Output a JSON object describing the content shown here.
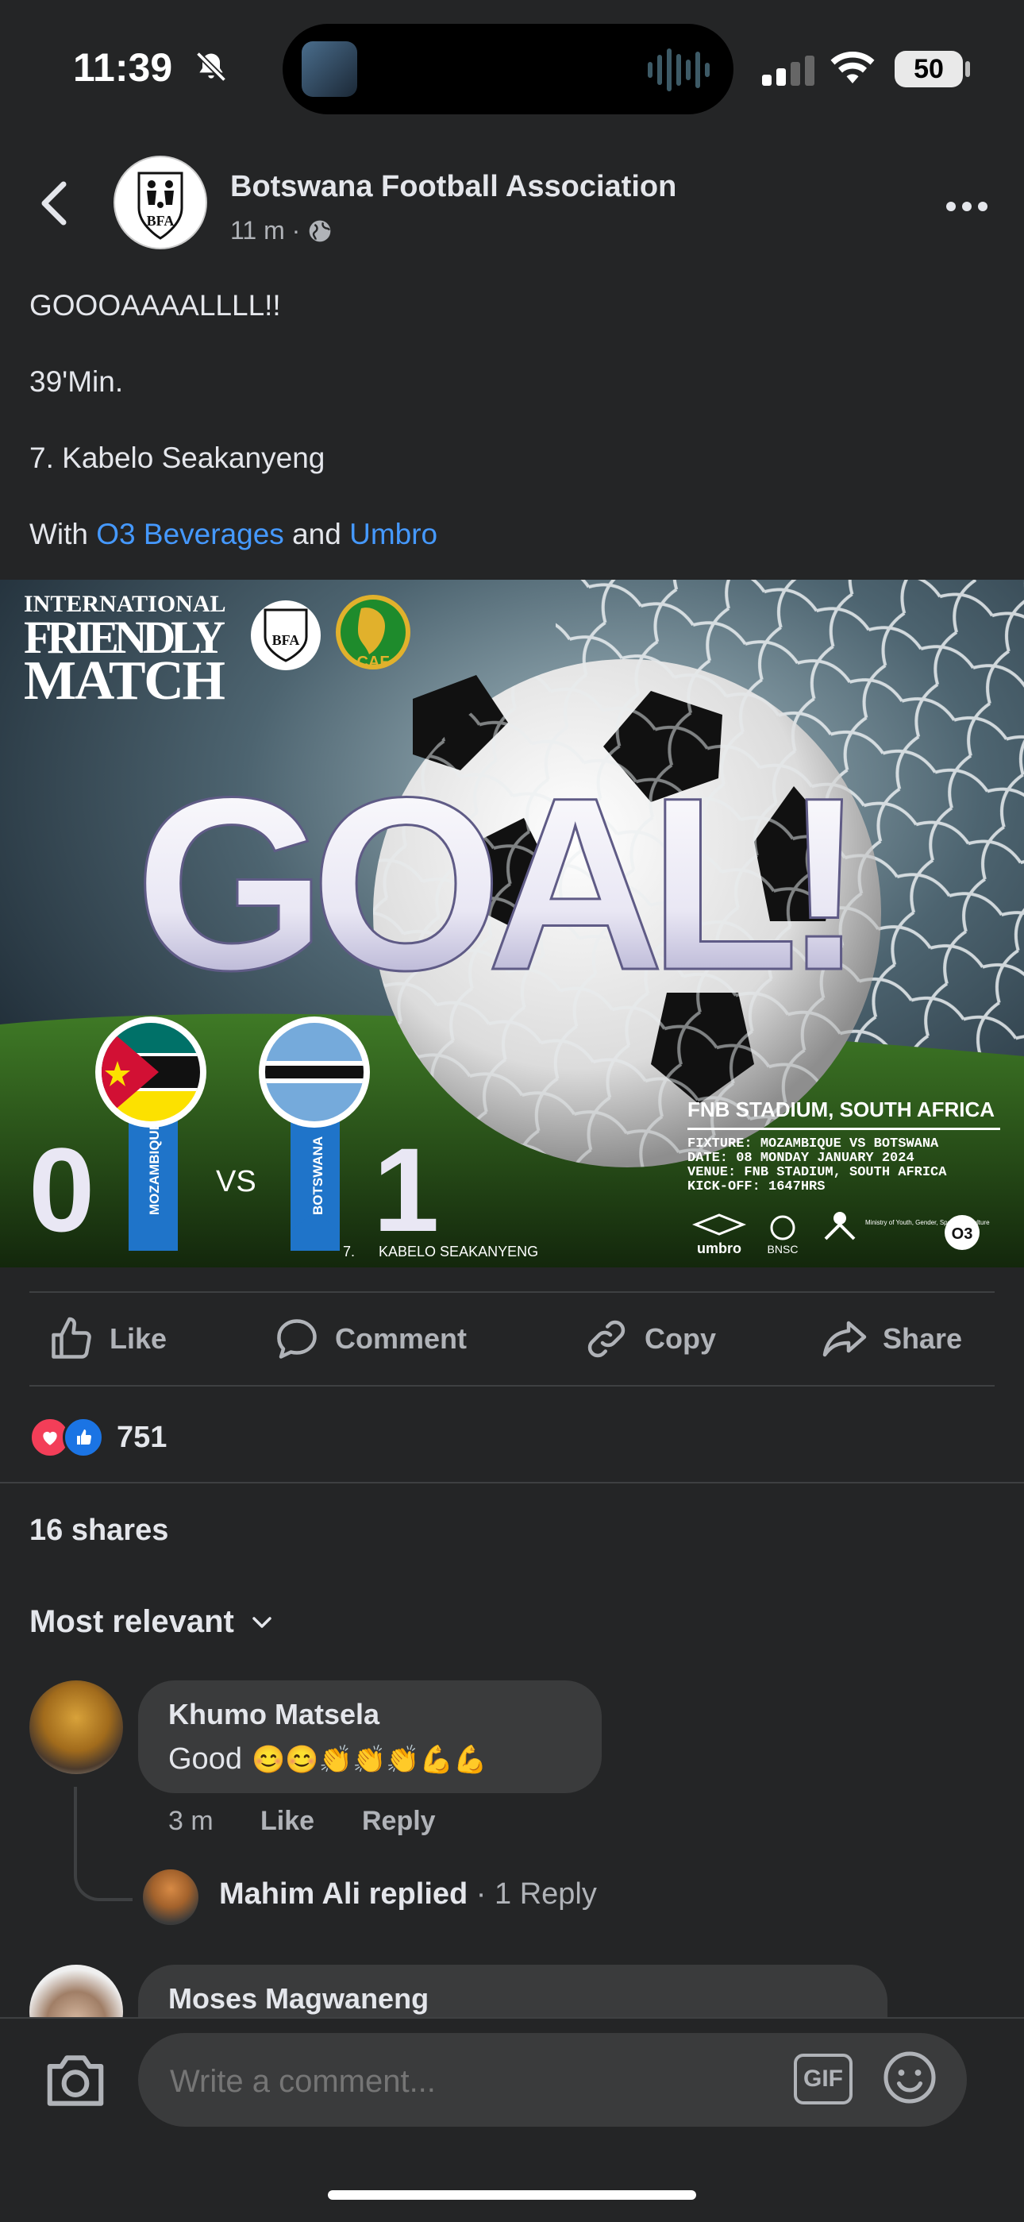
{
  "status": {
    "time": "11:39",
    "battery": "50"
  },
  "post": {
    "page_name": "Botswana Football Association",
    "avatar_text": "BFA",
    "time": "11 m",
    "lines": [
      "GOOOAAAALLLL!!",
      "39'Min.",
      "7. Kabelo Seakanyeng"
    ],
    "with_prefix": "With",
    "sponsor_1": "O3 Beverages",
    "and_word": "and",
    "sponsor_2": "Umbro"
  },
  "graphic": {
    "header_1": "INTERNATIONAL",
    "header_2": "FRIENDLY",
    "header_3": "MATCH",
    "bfa": "BFA",
    "caf": "CAF",
    "headline": "GOAL!",
    "home_team": "MOZAMBIQUE",
    "home_score": "0",
    "away_team": "BOTSWANA",
    "away_score": "1",
    "vs": "VS",
    "scorer": "7.      KABELO SEAKANYENG",
    "stadium": "FNB STADIUM, SOUTH AFRICA",
    "fixture": "FIXTURE: MOZAMBIQUE VS BOTSWANA",
    "date": "DATE: 08 MONDAY JANUARY 2024",
    "venue": "VENUE: FNB STADIUM, SOUTH AFRICA",
    "kickoff": "KICK-OFF: 1647HRS",
    "logo_umbro": "umbro",
    "logo_bnsc": "BNSC",
    "logo_ministry": "Ministry of Youth, Gender, Sport and Culture",
    "logo_o3": "O3"
  },
  "actions": {
    "like": "Like",
    "comment": "Comment",
    "copy": "Copy",
    "share": "Share"
  },
  "reactions": {
    "count": "751"
  },
  "shares": "16 shares",
  "sort": {
    "label": "Most relevant"
  },
  "comments": [
    {
      "name": "Khumo Matsela",
      "text": "Good",
      "emojis": "😊😊👏👏👏💪💪",
      "time": "3 m",
      "like": "Like",
      "reply": "Reply",
      "reply_summary": {
        "name": "Mahim Ali",
        "verb": "replied",
        "count": " · 1 Reply"
      }
    },
    {
      "name": "Moses Magwaneng"
    }
  ],
  "composer": {
    "placeholder": "Write a comment...",
    "gif": "GIF"
  }
}
